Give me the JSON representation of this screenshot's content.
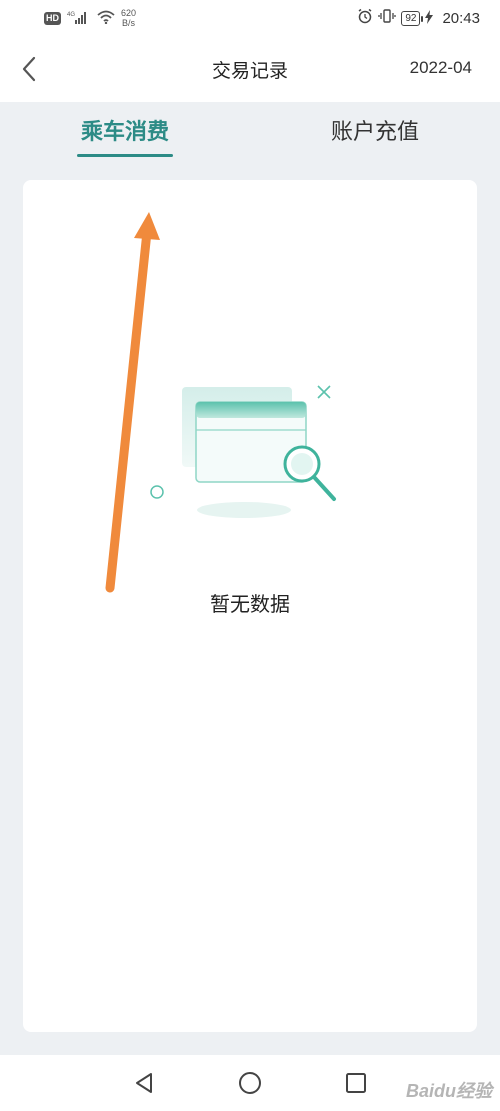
{
  "status_bar": {
    "hd": "HD",
    "signal": "4G",
    "net_speed_value": "620",
    "net_speed_unit": "B/s",
    "battery": "92",
    "time": "20:43"
  },
  "header": {
    "title": "交易记录",
    "month": "2022-04"
  },
  "tabs": [
    {
      "label": "乘车消费",
      "active": true
    },
    {
      "label": "账户充值",
      "active": false
    }
  ],
  "empty_state": {
    "message": "暂无数据"
  },
  "colors": {
    "accent": "#2c8b86",
    "annotation_arrow": "#f08a3c"
  },
  "watermark": "Baidu经验"
}
